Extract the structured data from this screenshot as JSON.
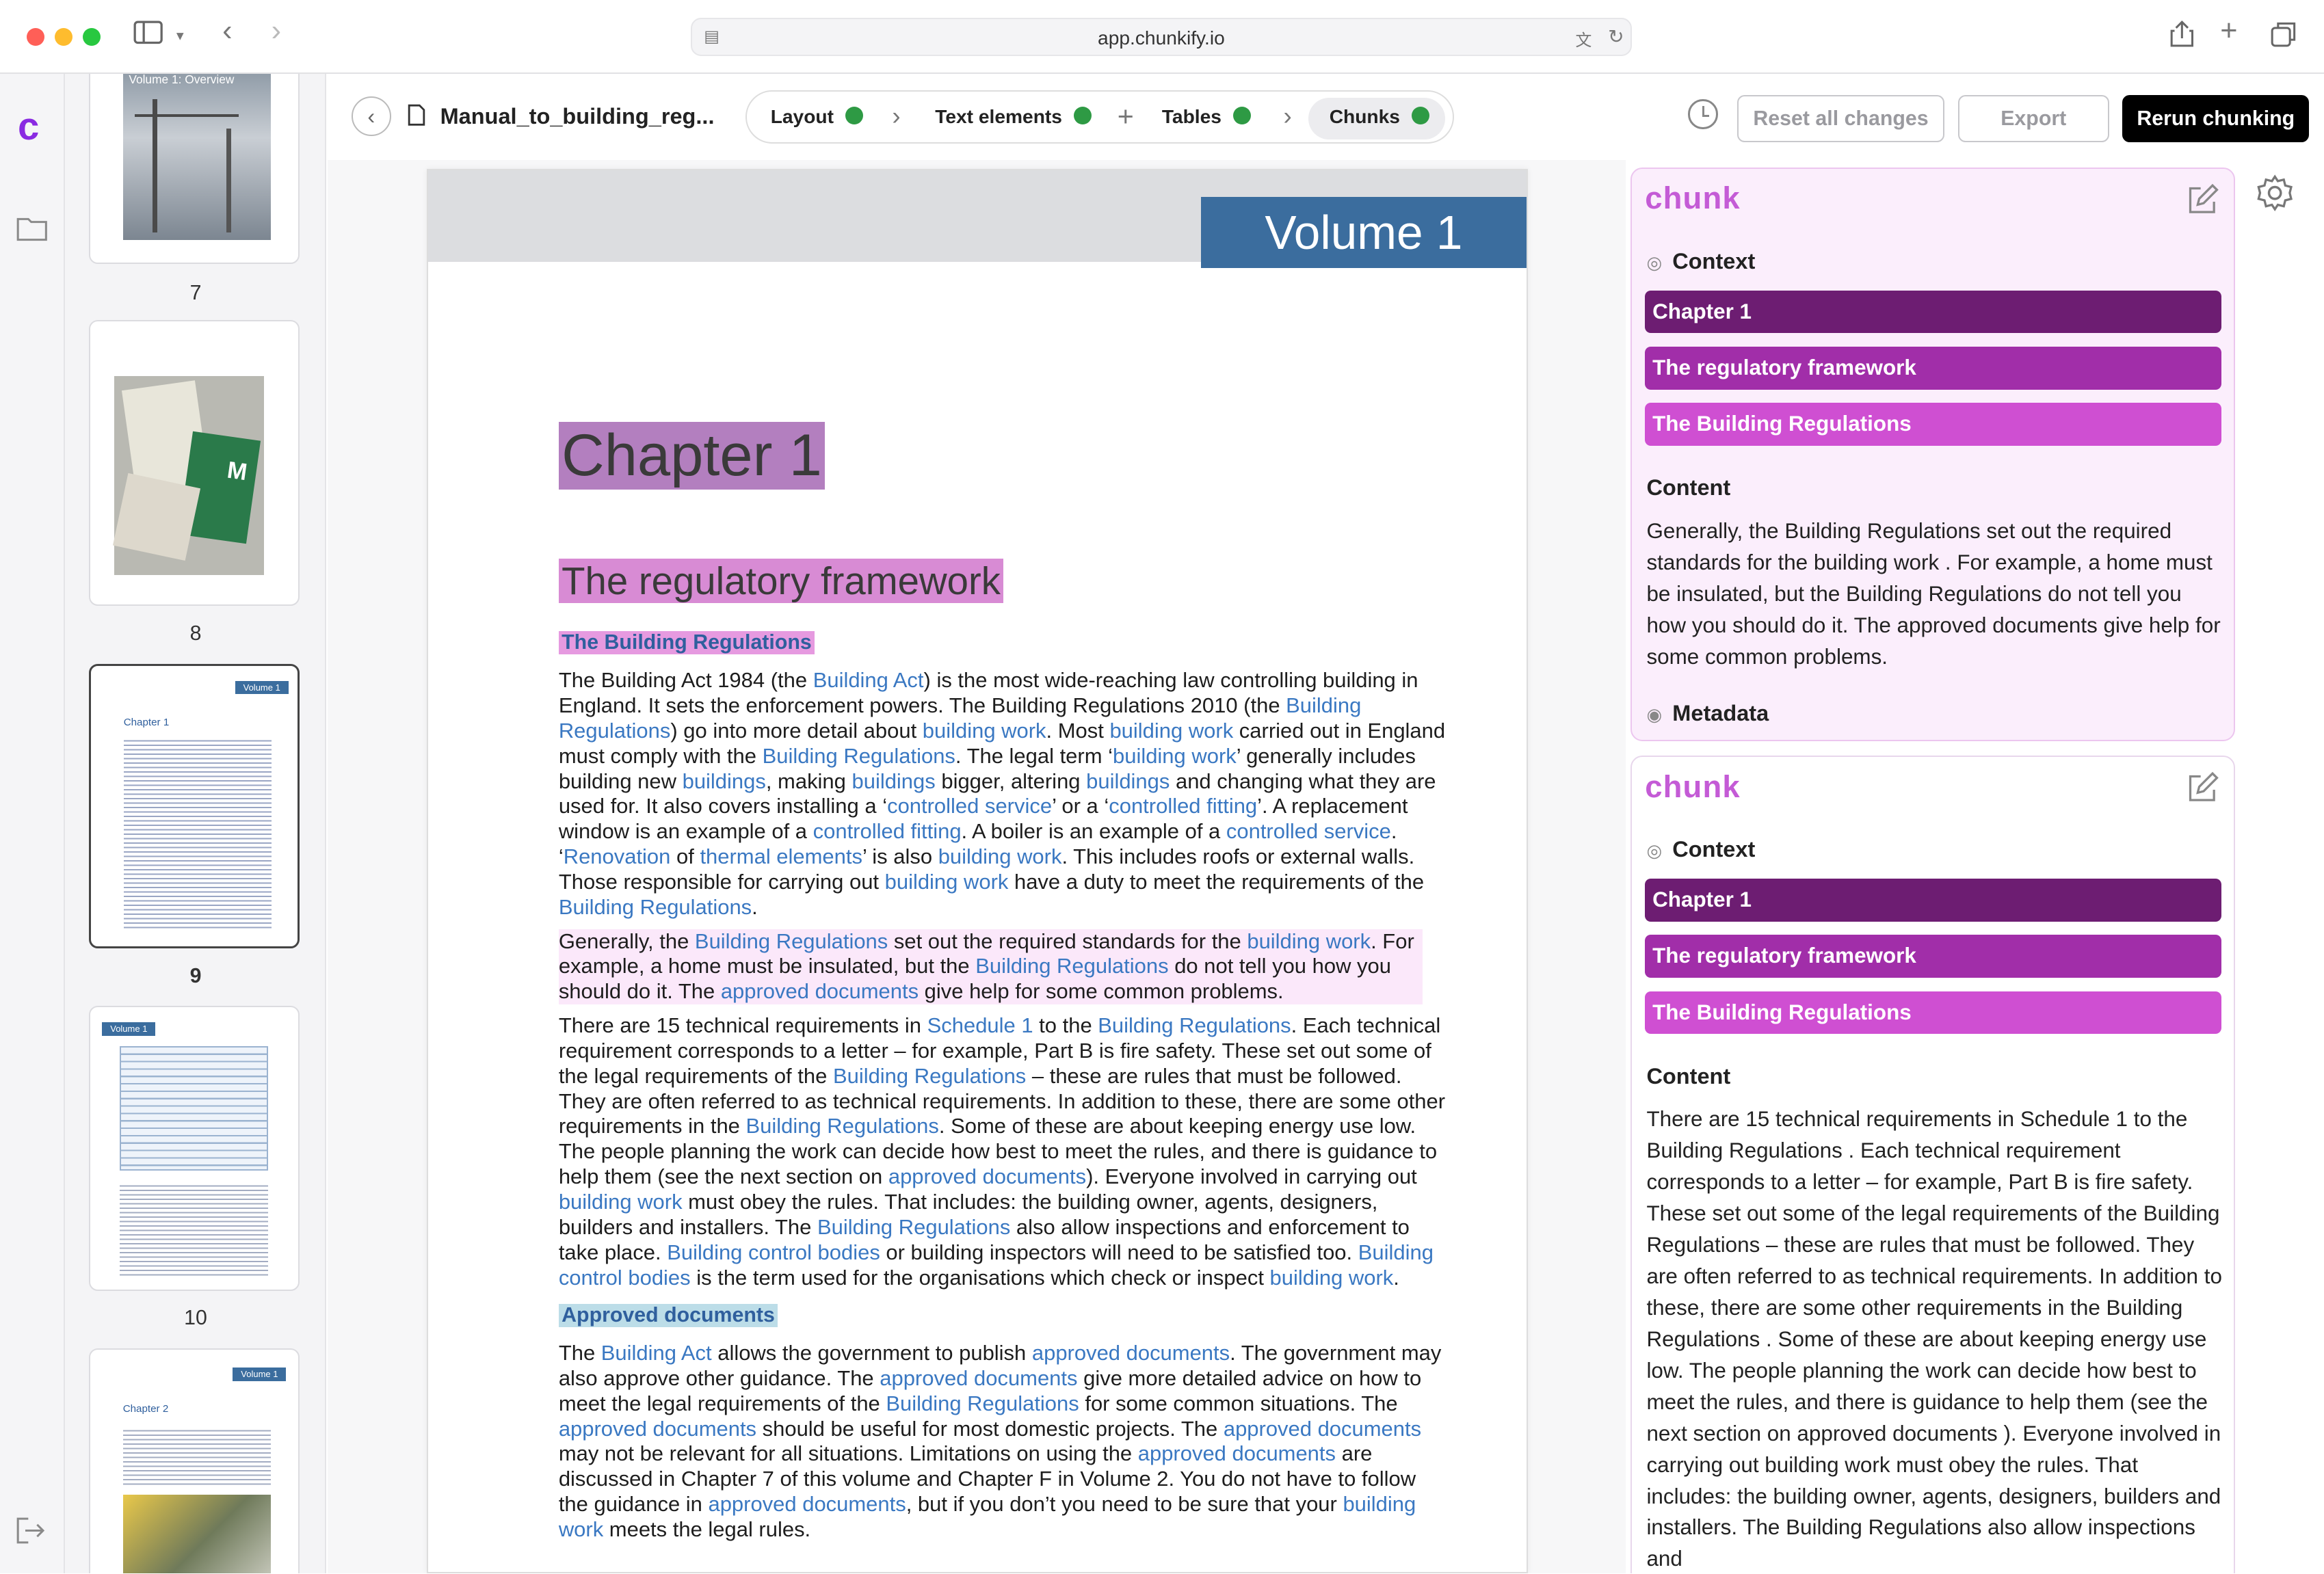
{
  "browser": {
    "url": "app.chunkify.io"
  },
  "app": {
    "logo": "c",
    "filename": "Manual_to_building_reg..."
  },
  "thumbnails": [
    {
      "page": "7",
      "caption": "Volume 1: Overview"
    },
    {
      "page": "8"
    },
    {
      "page": "9",
      "badge": "Volume 1",
      "heading": "Chapter 1"
    },
    {
      "page": "10",
      "badge": "Volume 1"
    },
    {
      "page": "",
      "badge": "Volume 1",
      "heading": "Chapter 2"
    }
  ],
  "steps": [
    {
      "label": "Layout",
      "status": "done"
    },
    {
      "label": "Text elements",
      "status": "done"
    },
    {
      "label": "Tables",
      "status": "done"
    },
    {
      "label": "Chunks",
      "status": "done"
    }
  ],
  "actions": {
    "reset": "Reset all changes",
    "export": "Export",
    "rerun": "Rerun chunking"
  },
  "colors": {
    "accent": "#8a2be2",
    "tag_chapter": "#6d1d72",
    "tag_framework": "#a12ea9",
    "tag_regulations": "#cf4fd2",
    "step_done": "#2e9a44",
    "link": "#3a78c2"
  },
  "document": {
    "volume": "Volume 1",
    "chapter": "Chapter 1",
    "section": "The regulatory framework",
    "subsection": "The Building Regulations",
    "p1": [
      [
        "The Building Act 1984 (the ",
        0
      ],
      [
        "Building Act",
        1
      ],
      [
        ") is the most wide-reaching law controlling building in England. It sets the enforcement powers. The Building Regulations 2010 (the ",
        0
      ],
      [
        "Building Regulations",
        1
      ],
      [
        ") go into more detail about ",
        0
      ],
      [
        "building work",
        1
      ],
      [
        ". Most ",
        0
      ],
      [
        "building work",
        1
      ],
      [
        " carried out in England must comply with the ",
        0
      ],
      [
        "Building Regulations",
        1
      ],
      [
        ". The legal term ‘",
        0
      ],
      [
        "building work",
        1
      ],
      [
        "’ generally includes building new ",
        0
      ],
      [
        "buildings",
        1
      ],
      [
        ", making ",
        0
      ],
      [
        "buildings",
        1
      ],
      [
        " bigger, altering ",
        0
      ],
      [
        "buildings",
        1
      ],
      [
        " and changing what they are used for. It also covers installing a ‘",
        0
      ],
      [
        "controlled service",
        1
      ],
      [
        "’ or a ‘",
        0
      ],
      [
        "controlled fitting",
        1
      ],
      [
        "’. A replacement window is an example of a ",
        0
      ],
      [
        "controlled fitting",
        1
      ],
      [
        ". A boiler is an example of a ",
        0
      ],
      [
        "controlled service",
        1
      ],
      [
        ". ‘",
        0
      ],
      [
        "Renovation",
        1
      ],
      [
        " of ",
        0
      ],
      [
        "thermal elements",
        1
      ],
      [
        "’ is also ",
        0
      ],
      [
        "building work",
        1
      ],
      [
        ". This includes roofs or external walls. Those responsible for carrying out ",
        0
      ],
      [
        "building work",
        1
      ],
      [
        " have a duty to meet the requirements of the ",
        0
      ],
      [
        "Building Regulations",
        1
      ],
      [
        ".",
        0
      ]
    ],
    "p2": [
      [
        "Generally, the ",
        0
      ],
      [
        "Building Regulations",
        1
      ],
      [
        " set out the required standards for the ",
        0
      ],
      [
        "building work",
        1
      ],
      [
        ". For example, a home must be insulated, but the ",
        0
      ],
      [
        "Building Regulations",
        1
      ],
      [
        " do not tell you how you should do it. The ",
        0
      ],
      [
        "approved documents",
        1
      ],
      [
        " give help for some common problems.",
        0
      ]
    ],
    "p3": [
      [
        "There are 15 technical requirements in ",
        0
      ],
      [
        "Schedule 1",
        1
      ],
      [
        " to the ",
        0
      ],
      [
        "Building Regulations",
        1
      ],
      [
        ". Each technical requirement corresponds to a letter – for example, Part B is fire safety. These set out some of the legal requirements of the ",
        0
      ],
      [
        "Building Regulations",
        1
      ],
      [
        " – these are rules that must be followed. They are often referred to as technical requirements. In addition to these, there are some other requirements in the ",
        0
      ],
      [
        "Building Regulations",
        1
      ],
      [
        ". Some of these are about keeping energy use low. The people planning the work can decide how best to meet the rules, and there is guidance to help them (see the next section on ",
        0
      ],
      [
        "approved documents",
        1
      ],
      [
        "). Everyone involved in carrying out ",
        0
      ],
      [
        "building work",
        1
      ],
      [
        " must obey the rules. That includes: the building owner, agents, designers, builders and installers. The ",
        0
      ],
      [
        "Building Regulations",
        1
      ],
      [
        " also allow inspections and enforcement to take place. ",
        0
      ],
      [
        "Building control bodies",
        1
      ],
      [
        " or building inspectors will need to be satisfied too. ",
        0
      ],
      [
        "Building control bodies",
        1
      ],
      [
        " is the term used for the organisations which check or inspect ",
        0
      ],
      [
        "building work",
        1
      ],
      [
        ".",
        0
      ]
    ],
    "approved_heading": "Approved documents",
    "p4": [
      [
        "The ",
        0
      ],
      [
        "Building Act",
        1
      ],
      [
        " allows the government to publish ",
        0
      ],
      [
        "approved documents",
        1
      ],
      [
        ". The government may also approve other guidance. The ",
        0
      ],
      [
        "approved documents",
        1
      ],
      [
        " give more detailed advice on how to meet the legal requirements of the ",
        0
      ],
      [
        "Building Regulations",
        1
      ],
      [
        " for some common situations. The ",
        0
      ],
      [
        "approved documents",
        1
      ],
      [
        " should be useful for most domestic projects. The ",
        0
      ],
      [
        "approved documents",
        1
      ],
      [
        " may not be relevant for all situations. Limitations on using the ",
        0
      ],
      [
        "approved documents",
        1
      ],
      [
        " are discussed in Chapter 7 of this volume and Chapter F in Volume 2. You do not have to follow the guidance in ",
        0
      ],
      [
        "approved documents",
        1
      ],
      [
        ", but if you don’t you need to be sure that your ",
        0
      ],
      [
        "building work",
        1
      ],
      [
        " meets the legal rules.",
        0
      ]
    ]
  },
  "chunks": [
    {
      "logo": "chunk",
      "context_label": "Context",
      "context": [
        "Chapter 1",
        "The regulatory framework",
        "The Building Regulations"
      ],
      "content_label": "Content",
      "content": "Generally, the Building Regulations set out the required standards for the building work . For example, a home must be insulated, but the Building Regulations do not tell you how you should do it. The approved documents give help for some common problems.",
      "metadata_label": "Metadata"
    },
    {
      "logo": "chunk",
      "context_label": "Context",
      "context": [
        "Chapter 1",
        "The regulatory framework",
        "The Building Regulations"
      ],
      "content_label": "Content",
      "content": "There are 15 technical requirements in Schedule 1 to the Building Regulations . Each technical requirement corresponds to a letter – for example, Part B is fire safety. These set out some of the legal requirements of the Building Regulations – these are rules that must be followed. They are often referred to as technical requirements. In addition to these, there are some other requirements in the Building Regulations . Some of these are about keeping energy use low. The people planning the work can decide how best to meet the rules, and there is guidance to help them (see the next section on approved documents ). Everyone involved in carrying out building work must obey the rules. That includes: the building owner, agents, designers, builders and installers. The Building Regulations also allow inspections and"
    }
  ]
}
